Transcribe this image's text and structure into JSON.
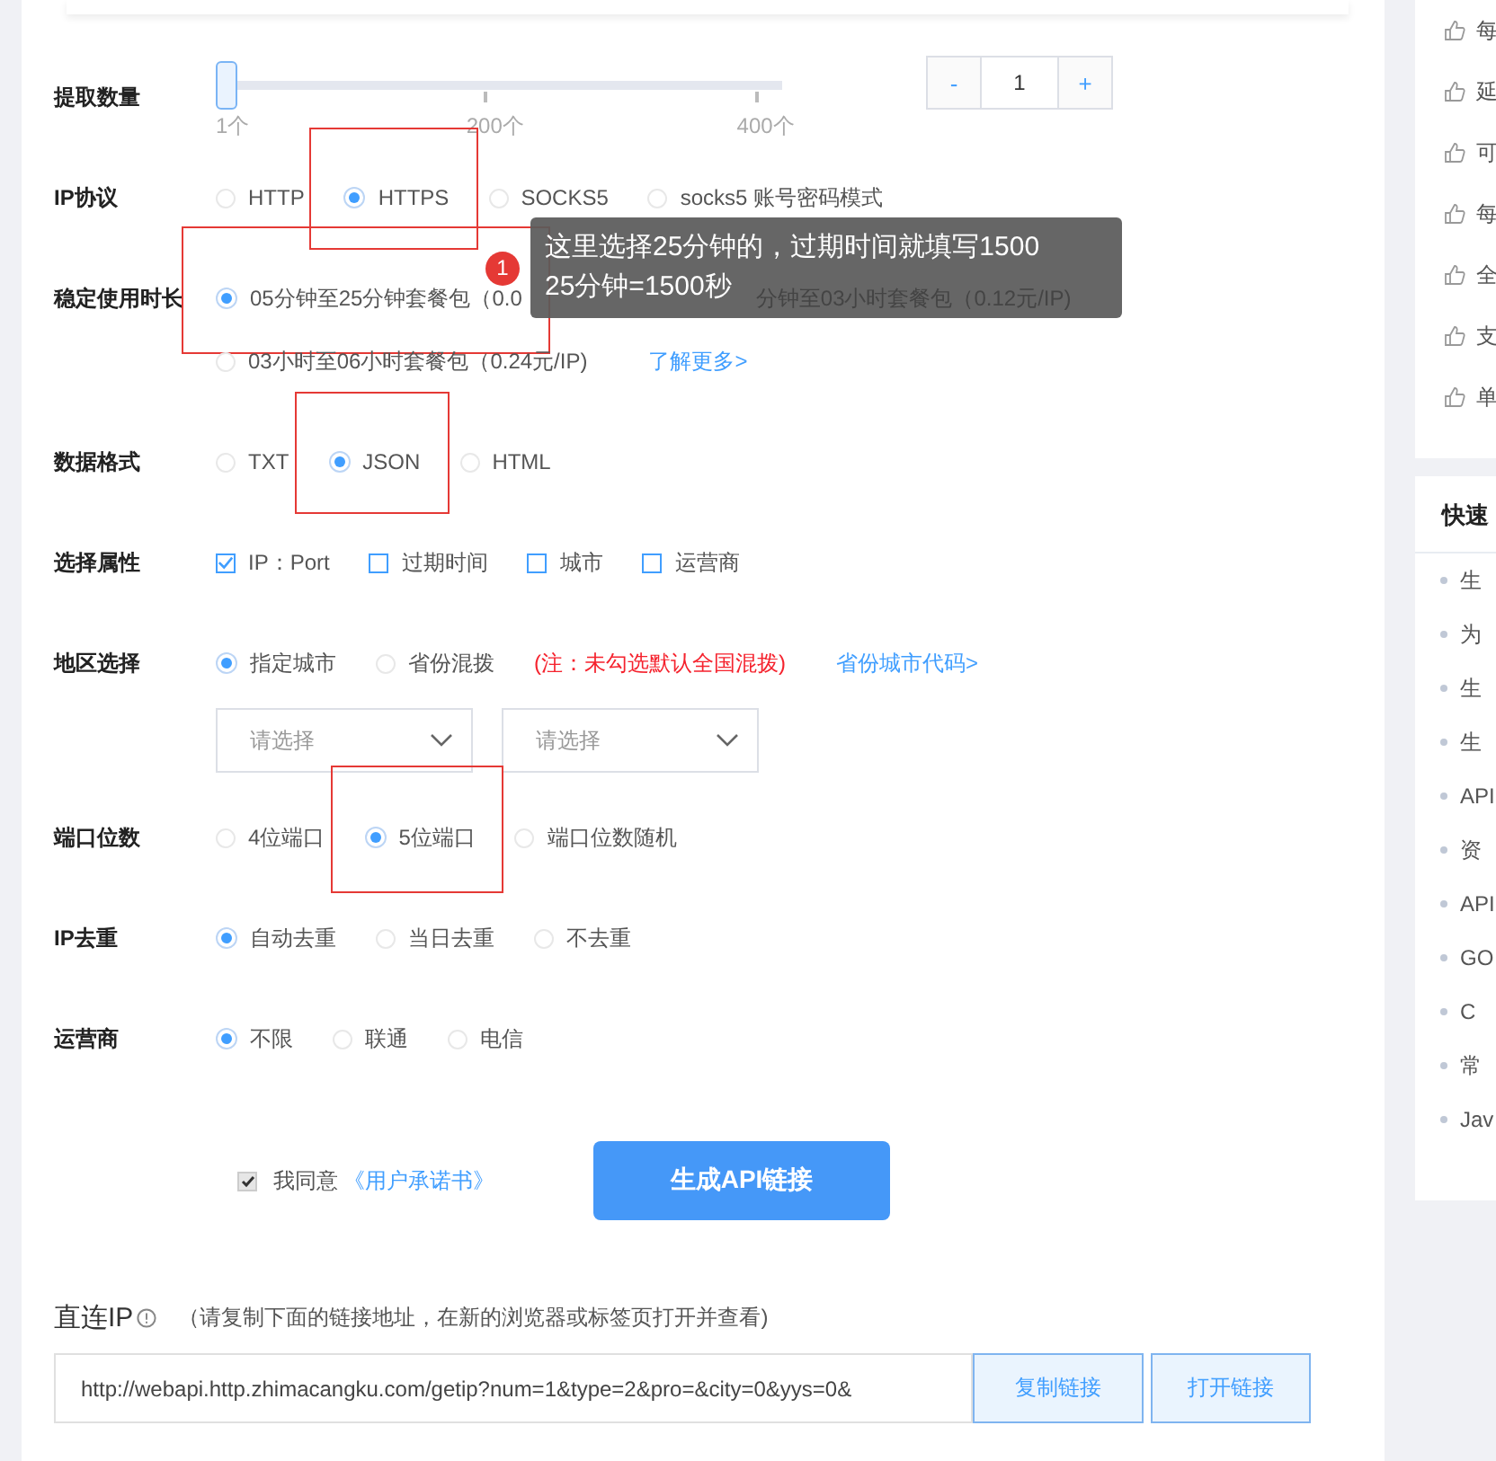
{
  "form": {
    "rows": [
      {
        "kind": "slider",
        "label": "提取数量",
        "level": 0,
        "ticks": [
          "1个",
          "200个",
          "400个"
        ],
        "stepper": {
          "minus": "-",
          "value": "1",
          "plus": "+"
        }
      },
      {
        "kind": "radio",
        "label": "IP协议",
        "lines": [
          [
            {
              "text": "HTTP",
              "selected": false,
              "highlighted": false
            },
            {
              "text": "HTTPS",
              "selected": true,
              "highlighted": true
            },
            {
              "text": "SOCKS5",
              "selected": false,
              "highlighted": false
            },
            {
              "text": "socks5 账号密码模式",
              "selected": false,
              "highlighted": false
            }
          ]
        ]
      },
      {
        "kind": "radio",
        "label": "稳定使用时长",
        "callout": {
          "number": "1",
          "lines": [
            "这里选择25分钟的，过期时间就填写1500",
            "25分钟=1500秒"
          ]
        },
        "lines": [
          [
            {
              "text": "05分钟至25分钟套餐包（0.0",
              "selected": true,
              "highlighted": true
            },
            {
              "text": "分钟至03小时套餐包（0.12元/IP)",
              "selected": false,
              "highlighted": false,
              "covered": true
            }
          ],
          [
            {
              "text": "03小时至06小时套餐包（0.24元/IP)",
              "selected": false,
              "highlighted": false
            }
          ]
        ],
        "link": "了解更多>"
      },
      {
        "kind": "radio",
        "label": "数据格式",
        "lines": [
          [
            {
              "text": "TXT",
              "selected": false,
              "highlighted": false
            },
            {
              "text": "JSON",
              "selected": true,
              "highlighted": true
            },
            {
              "text": "HTML",
              "selected": false,
              "highlighted": false
            }
          ]
        ]
      },
      {
        "kind": "checkbox",
        "label": "选择属性",
        "lines": [
          [
            {
              "text": "IP：Port",
              "checked": true
            },
            {
              "text": "过期时间",
              "checked": false
            },
            {
              "text": "城市",
              "checked": false
            },
            {
              "text": "运营商",
              "checked": false
            }
          ]
        ]
      },
      {
        "kind": "region",
        "label": "地区选择",
        "lines": [
          [
            {
              "text": "指定城市",
              "selected": true,
              "highlighted": false
            },
            {
              "text": "省份混拨",
              "selected": false,
              "highlighted": false
            }
          ]
        ],
        "note": "(注：未勾选默认全国混拨)",
        "link": "省份城市代码>",
        "selects": [
          {
            "placeholder": "请选择"
          },
          {
            "placeholder": "请选择"
          }
        ]
      },
      {
        "kind": "radio",
        "label": "端口位数",
        "lines": [
          [
            {
              "text": "4位端口",
              "selected": false,
              "highlighted": false
            },
            {
              "text": "5位端口",
              "selected": true,
              "highlighted": true
            },
            {
              "text": "端口位数随机",
              "selected": false,
              "highlighted": false
            }
          ]
        ]
      },
      {
        "kind": "radio",
        "label": "IP去重",
        "lines": [
          [
            {
              "text": "自动去重",
              "selected": true,
              "highlighted": false
            },
            {
              "text": "当日去重",
              "selected": false,
              "highlighted": false
            },
            {
              "text": "不去重",
              "selected": false,
              "highlighted": false
            }
          ]
        ]
      },
      {
        "kind": "radio",
        "label": "运营商",
        "lines": [
          [
            {
              "text": "不限",
              "selected": true,
              "highlighted": false
            },
            {
              "text": "联通",
              "selected": false,
              "highlighted": false
            },
            {
              "text": "电信",
              "selected": false,
              "highlighted": false
            }
          ]
        ]
      }
    ],
    "agree": {
      "checked": true,
      "text": "我同意",
      "link": "《用户承诺书》"
    },
    "submit": "生成API链接"
  },
  "direct_ip": {
    "title": "直连IP",
    "hint": "（请复制下面的链接地址，在新的浏览器或标签页打开并查看)",
    "url": "http://webapi.http.zhimacangku.com/getip?num=1&type=2&pro=&city=0&yys=0&",
    "buttons": [
      "复制链接",
      "打开链接"
    ]
  },
  "sidebar": {
    "features": [
      "每",
      "延",
      "可",
      "每",
      "全",
      "支",
      "单"
    ],
    "quick": {
      "title": "快速",
      "items": [
        "生",
        "为",
        "生",
        "生",
        "API",
        "资",
        "API",
        "GO",
        "C",
        "常",
        "Jav"
      ]
    }
  }
}
